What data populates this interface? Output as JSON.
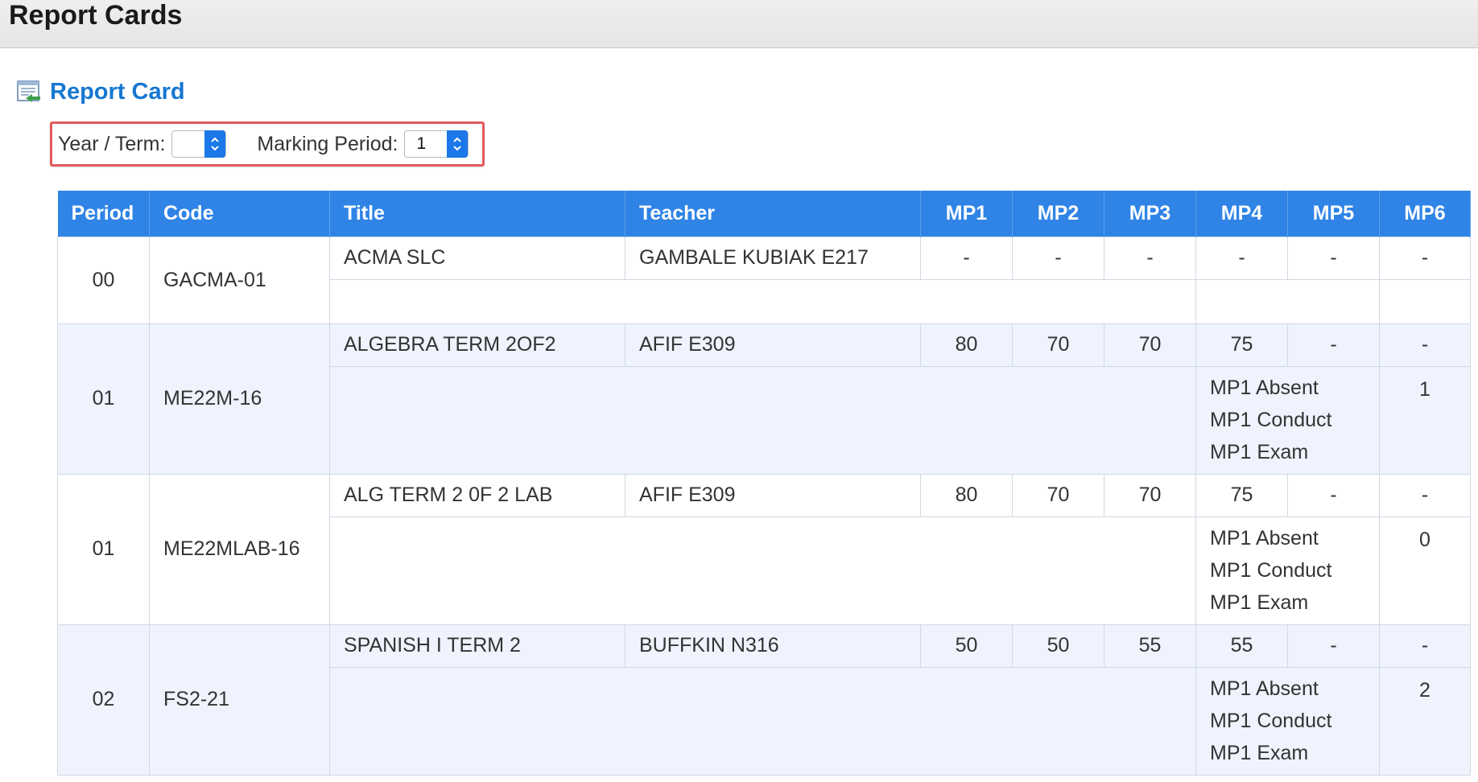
{
  "header": {
    "title": "Report Cards"
  },
  "section": {
    "title": "Report Card"
  },
  "filters": {
    "year_term_label": "Year / Term:",
    "year_term_value": "",
    "marking_period_label": "Marking Period:",
    "marking_period_value": "1"
  },
  "table": {
    "headers": {
      "period": "Period",
      "code": "Code",
      "title": "Title",
      "teacher": "Teacher",
      "mp1": "MP1",
      "mp2": "MP2",
      "mp3": "MP3",
      "mp4": "MP4",
      "mp5": "MP5",
      "mp6": "MP6"
    },
    "rows": [
      {
        "period": "00",
        "code": "GACMA-01",
        "title": "ACMA SLC",
        "teacher": "GAMBALE KUBIAK E217",
        "mp": [
          "-",
          "-",
          "-",
          "-",
          "-",
          "-"
        ]
      },
      {
        "period": "01",
        "code": "ME22M-16",
        "title": "ALGEBRA TERM 2OF2",
        "teacher": "AFIF E309",
        "mp": [
          "80",
          "70",
          "70",
          "75",
          "-",
          "-"
        ],
        "extras": [
          "MP1 Absent",
          "MP1 Conduct",
          "MP1 Exam"
        ],
        "extra_value": "1"
      },
      {
        "period": "01",
        "code": "ME22MLAB-16",
        "title": "ALG TERM 2 0F 2 LAB",
        "teacher": "AFIF E309",
        "mp": [
          "80",
          "70",
          "70",
          "75",
          "-",
          "-"
        ],
        "extras": [
          "MP1 Absent",
          "MP1 Conduct",
          "MP1 Exam"
        ],
        "extra_value": "0"
      },
      {
        "period": "02",
        "code": "FS2-21",
        "title": "SPANISH I TERM 2",
        "teacher": "BUFFKIN N316",
        "mp": [
          "50",
          "50",
          "55",
          "55",
          "-",
          "-"
        ],
        "extras": [
          "MP1 Absent",
          "MP1 Conduct",
          "MP1 Exam"
        ],
        "extra_value": "2"
      }
    ]
  },
  "colors": {
    "header_blue": "#2f84e6",
    "link_blue": "#1677d2",
    "alt_row": "#eef3fd",
    "highlight_red": "#e45b5b"
  }
}
